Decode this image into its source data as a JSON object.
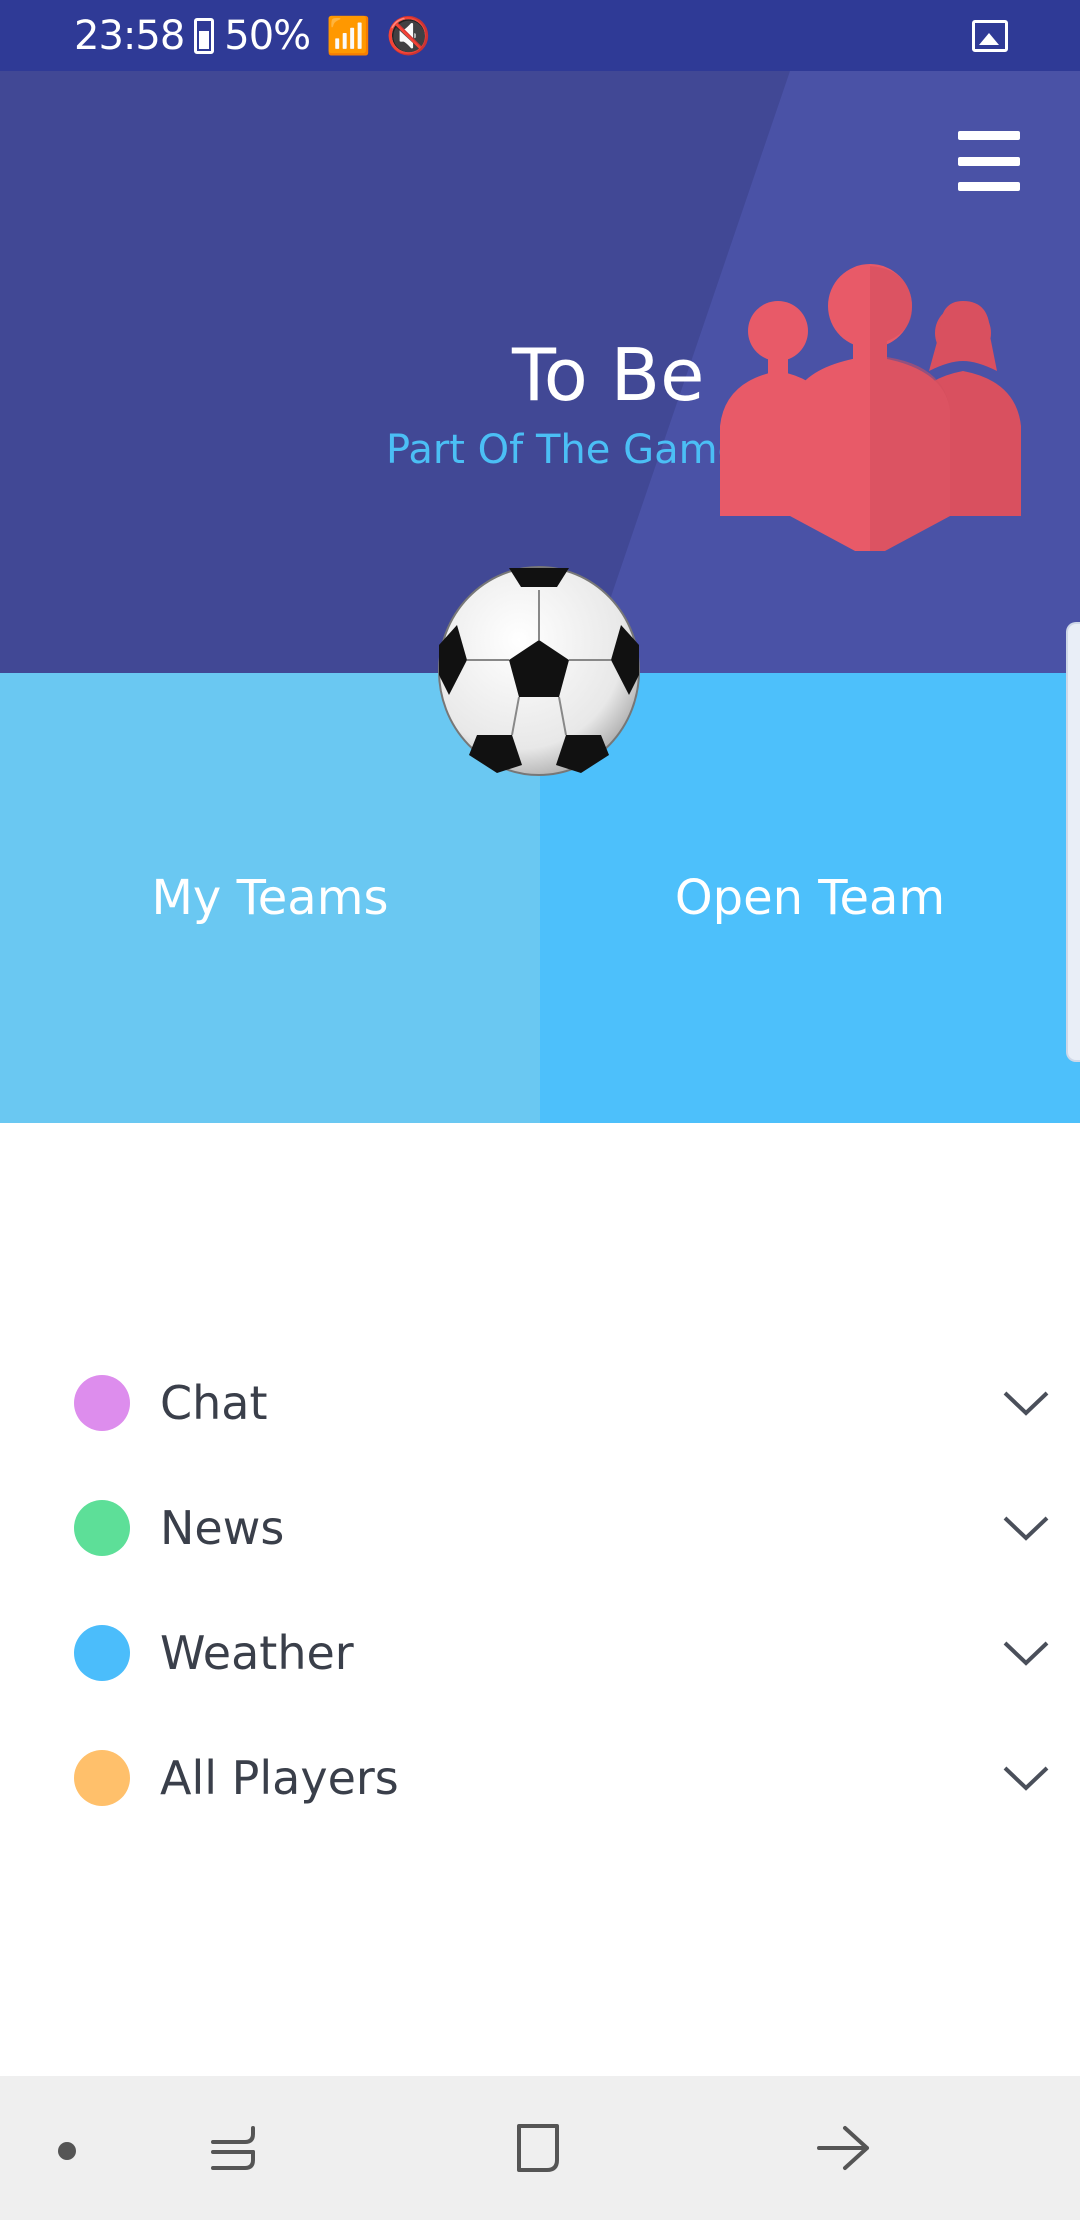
{
  "status_bar": {
    "time": "23:58",
    "battery": "50%",
    "icons": [
      "battery-icon",
      "signal-icon",
      "wifi-icon",
      "mute-icon",
      "gallery-icon"
    ]
  },
  "header": {
    "title": "To Be",
    "subtitle": "Part Of The Game",
    "colors": {
      "bg": "#414895",
      "accent": "#4bbff5",
      "people": "#e85a68"
    }
  },
  "buttons": {
    "left": "My Teams",
    "right": "Open Team"
  },
  "list": [
    {
      "label": "Chat",
      "color": "#dd8ded"
    },
    {
      "label": "News",
      "color": "#5ddf98"
    },
    {
      "label": "Weather",
      "color": "#4bbdfb"
    },
    {
      "label": "All Players",
      "color": "#ffc06b"
    }
  ],
  "nav": {
    "icons": [
      "dot-icon",
      "recent-apps-icon",
      "home-icon",
      "back-icon"
    ]
  }
}
